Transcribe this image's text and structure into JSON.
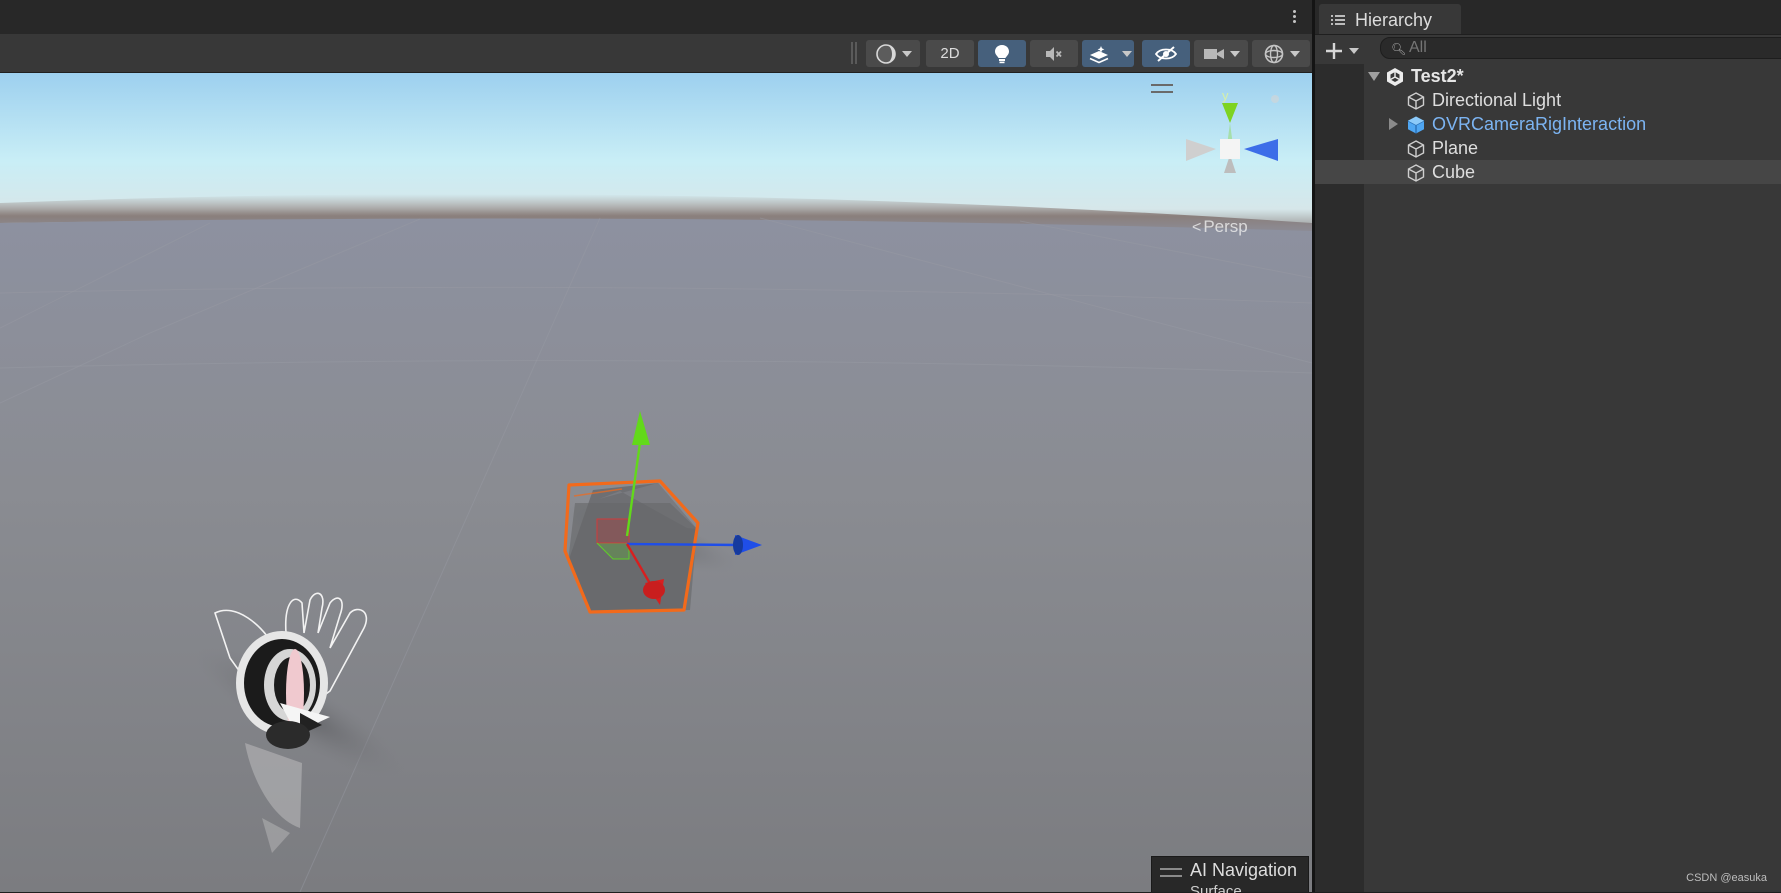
{
  "scene_view": {
    "menu_icon": "kebab-menu-icon",
    "toolbar": {
      "draw_mode_icon": "shaded-sphere-icon",
      "mode_2d_label": "2D",
      "lighting_icon": "lightbulb-icon",
      "lighting_on": true,
      "audio_icon": "audio-mute-icon",
      "effects_icon": "effects-layers-icon",
      "effects_on": true,
      "visibility_icon": "hidden-eye-icon",
      "visibility_on": true,
      "camera_icon": "scene-camera-icon",
      "gizmos_icon": "gizmos-globe-icon"
    },
    "orientation_gizmo": {
      "y_axis_label": "y",
      "projection_label": "Persp"
    },
    "overlay": {
      "title": "AI Navigation",
      "subtitle": "Surface"
    },
    "colors": {
      "sky_top": "#9dd0ef",
      "sky_horizon": "#c9eef6",
      "ground": "#8a8d95",
      "selection_outline": "#f26a1b",
      "axis_x": "#d81f1f",
      "axis_y": "#62d91a",
      "axis_z": "#1f4ee8"
    }
  },
  "hierarchy": {
    "tab_title": "Hierarchy",
    "tab_icon": "list-icon",
    "add_icon": "plus-icon",
    "search_icon": "search-icon",
    "search_placeholder": "All",
    "scene": {
      "name": "Test2*",
      "expanded": true
    },
    "items": [
      {
        "label": "Directional Light",
        "kind": "gameobject",
        "expandable": false,
        "selected": false
      },
      {
        "label": "OVRCameraRigInteraction",
        "kind": "prefab",
        "expandable": true,
        "selected": false
      },
      {
        "label": "Plane",
        "kind": "gameobject",
        "expandable": false,
        "selected": false
      },
      {
        "label": "Cube",
        "kind": "gameobject",
        "expandable": false,
        "selected": true
      }
    ]
  },
  "watermark": "CSDN @easuka"
}
